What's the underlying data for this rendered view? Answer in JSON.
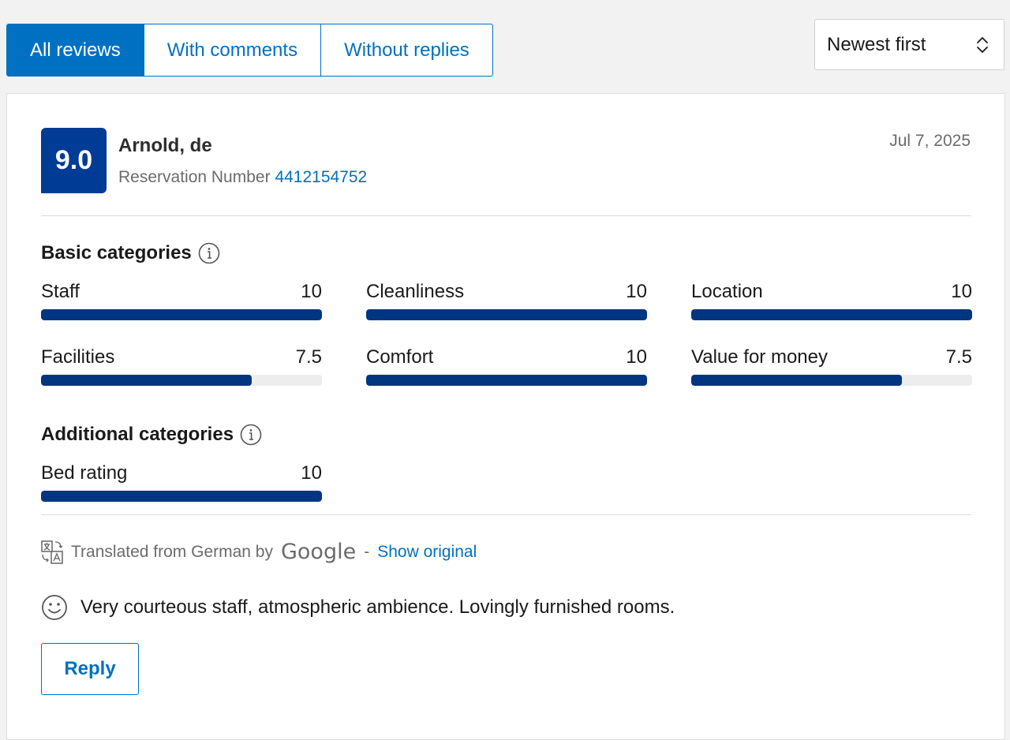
{
  "filters": {
    "tabs": [
      {
        "label": "All reviews",
        "active": true
      },
      {
        "label": "With comments",
        "active": false
      },
      {
        "label": "Without replies",
        "active": false
      }
    ],
    "sort": {
      "selected": "Newest first"
    }
  },
  "review": {
    "score": "9.0",
    "reviewer": "Arnold, de",
    "reservation_label": "Reservation Number",
    "reservation_number": "4412154752",
    "date": "Jul 7, 2025",
    "basic_title": "Basic categories",
    "basic": [
      {
        "name": "Staff",
        "value": "10",
        "fraction": 1.0
      },
      {
        "name": "Cleanliness",
        "value": "10",
        "fraction": 1.0
      },
      {
        "name": "Location",
        "value": "10",
        "fraction": 1.0
      },
      {
        "name": "Facilities",
        "value": "7.5",
        "fraction": 0.75
      },
      {
        "name": "Comfort",
        "value": "10",
        "fraction": 1.0
      },
      {
        "name": "Value for money",
        "value": "7.5",
        "fraction": 0.75
      }
    ],
    "additional_title": "Additional categories",
    "additional": [
      {
        "name": "Bed rating",
        "value": "10",
        "fraction": 1.0
      }
    ],
    "translation": {
      "text": "Translated from German by",
      "provider": "Google",
      "separator": "-",
      "show_original": "Show original"
    },
    "comment": "Very courteous staff, atmospheric ambience. Lovingly furnished rooms.",
    "reply_label": "Reply"
  },
  "colors": {
    "accent": "#0071c2",
    "score_bg": "#003b95",
    "bar_fill": "#003580"
  },
  "icons": [
    "info-icon",
    "translate-icon",
    "smiley-icon",
    "chevron-updown-icon"
  ]
}
